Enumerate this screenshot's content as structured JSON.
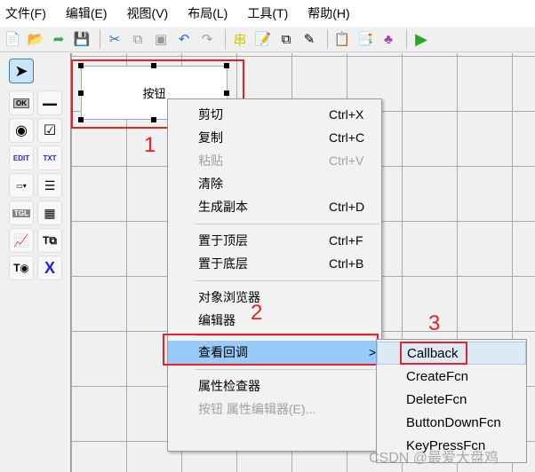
{
  "menubar": [
    "文件(F)",
    "编辑(E)",
    "视图(V)",
    "布局(L)",
    "工具(T)",
    "帮助(H)"
  ],
  "toolbar": [
    "new-file-icon",
    "open-folder-icon",
    "export-icon",
    "save-icon",
    "cut-icon",
    "copy-icon",
    "paste-icon",
    "undo-icon",
    "redo-icon",
    "align-icon",
    "menu-editor-icon",
    "tab-order-icon",
    "toolbar-editor-icon",
    "editor-icon",
    "property-inspector-icon",
    "object-browser-icon",
    "run-icon"
  ],
  "palette": [
    "select",
    "push-button",
    "slider",
    "radio-button",
    "checkbox",
    "edit-text",
    "static-text",
    "popup-menu",
    "listbox",
    "toggle-button",
    "table",
    "axes",
    "panel",
    "button-group",
    "activex"
  ],
  "palette_labels": {
    "push": "OK",
    "edit": "EDIT",
    "text": "TXT",
    "toggle": "TGL"
  },
  "canvas": {
    "button_label": "按钮"
  },
  "annotations": [
    "1",
    "2",
    "3"
  ],
  "context_menu": {
    "items": [
      {
        "label": "剪切",
        "shortcut": "Ctrl+X",
        "disabled": false
      },
      {
        "label": "复制",
        "shortcut": "Ctrl+C",
        "disabled": false
      },
      {
        "label": "粘贴",
        "shortcut": "Ctrl+V",
        "disabled": true
      },
      {
        "label": "清除",
        "shortcut": "",
        "disabled": false
      },
      {
        "label": "生成副本",
        "shortcut": "Ctrl+D",
        "disabled": false
      },
      {
        "label": "置于顶层",
        "shortcut": "Ctrl+F",
        "disabled": false
      },
      {
        "label": "置于底层",
        "shortcut": "Ctrl+B",
        "disabled": false
      },
      {
        "label": "对象浏览器",
        "shortcut": "",
        "disabled": false
      },
      {
        "label": "编辑器",
        "shortcut": "",
        "disabled": false
      },
      {
        "label": "查看回调",
        "shortcut": "",
        "disabled": false,
        "highlighted": true
      },
      {
        "label": "属性检查器",
        "shortcut": "",
        "disabled": false
      },
      {
        "label": "按钮 属性编辑器(E)...",
        "shortcut": "",
        "disabled": true
      }
    ],
    "submenu_arrow": ">"
  },
  "submenu": [
    "Callback",
    "CreateFcn",
    "DeleteFcn",
    "ButtonDownFcn",
    "KeyPressFcn"
  ],
  "watermark": "CSDN @最爱大盘鸡",
  "colors": {
    "highlight": "#99cbf8",
    "annotation": "#e8202a"
  }
}
